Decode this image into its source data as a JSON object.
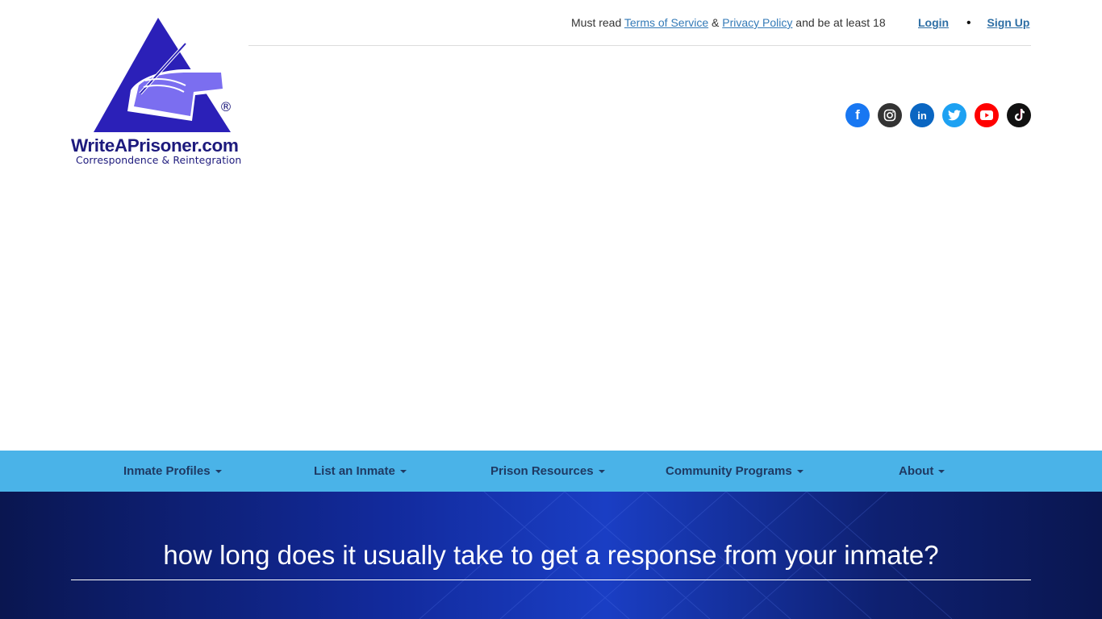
{
  "logo": {
    "title": "WriteAPrisoner.com",
    "subtitle": "Correspondence & Reintegration",
    "registered_mark": "®"
  },
  "topbar": {
    "notice_prefix": "Must read",
    "terms_link": "Terms of Service",
    "amp": "&",
    "privacy_link": "Privacy Policy",
    "notice_suffix": "and be at least 18",
    "login": "Login",
    "separator": "•",
    "signup": "Sign Up"
  },
  "social": [
    {
      "name": "facebook-icon",
      "glyph": "f",
      "color": "#1877f2"
    },
    {
      "name": "instagram-icon",
      "glyph": "",
      "color": "#333333"
    },
    {
      "name": "linkedin-icon",
      "glyph": "in",
      "color": "#0a66c2"
    },
    {
      "name": "twitter-icon",
      "glyph": "",
      "color": "#1da1f2"
    },
    {
      "name": "youtube-icon",
      "glyph": "",
      "color": "#ff0000"
    },
    {
      "name": "tiktok-icon",
      "glyph": "",
      "color": "#111111"
    }
  ],
  "nav": {
    "items": [
      {
        "label": "Inmate Profiles"
      },
      {
        "label": "List an Inmate"
      },
      {
        "label": "Prison Resources"
      },
      {
        "label": "Community Programs"
      },
      {
        "label": "About"
      }
    ]
  },
  "hero": {
    "title": "how long does it usually take to get a response from your inmate?"
  },
  "colors": {
    "brand_navy": "#1d1a7d",
    "nav_bg": "#4ab3e8",
    "link": "#337ab7"
  }
}
